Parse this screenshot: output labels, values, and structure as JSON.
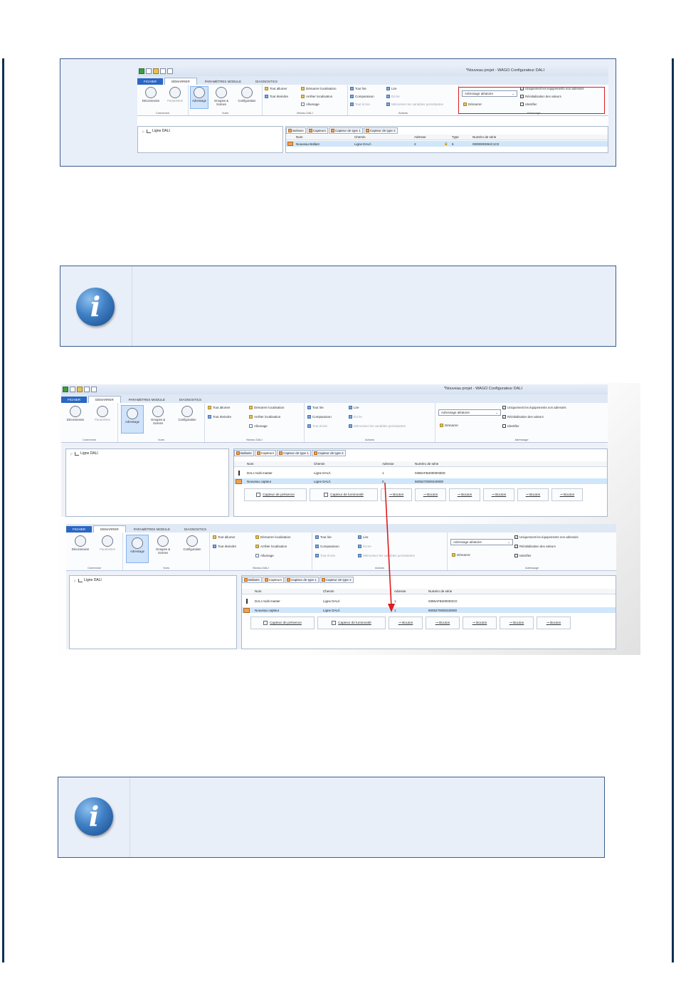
{
  "app": {
    "window_title": "*Nouveau projet - WAGO Configurateur DALI",
    "tabs": [
      "FICHIER",
      "DÉMARRER",
      "PARAMÈTRES MODULE",
      "DIAGNOSTICS"
    ]
  },
  "ribbon": {
    "connexion": {
      "deconnexion": "Déconnexion",
      "parametres": "Paramètres",
      "label": "Connexion"
    },
    "vues": {
      "adressage": "Adressage",
      "groupes": "Groupes & Scènes",
      "configuration": "Configuration",
      "label": "Vues"
    },
    "niveau": {
      "tout_allumer": "Tout allumer",
      "tout_eteindre": "Tout éteindre",
      "demarrer_loc": "Démarrer localisation",
      "arreter_loc": "Arrêter localisation",
      "allumage": "Allumage",
      "label": "Niveau DALI"
    },
    "actions": {
      "tout_lire": "Tout lire",
      "comparaison": "Comparaison",
      "tout_ecrire": "Tout écrire",
      "lire": "Lire",
      "ecrire": "Écrire",
      "memoriser": "Mémoriser les variables persistantes",
      "label": "Actions"
    },
    "adressage": {
      "mode": "Adressage aléatoire",
      "demarrer": "Démarrer",
      "opt1": "Uniquement les équipements non adressés",
      "opt2": "Réinitialisation des valeurs",
      "opt3": "Identifier",
      "label": "Adressage"
    }
  },
  "tree": {
    "root": "Ligne DALI"
  },
  "grid_tabs": [
    "Ballasts",
    "Capteurs",
    "Capteur de type 1",
    "Capteur de type 2"
  ],
  "grid_headers": [
    "Nom",
    "Chemin",
    "Adresse",
    "Type",
    "Numéro de série"
  ],
  "screenshot1": {
    "rows": [
      {
        "nom": "Nouveau Ballast",
        "chemin": "Ligne DALI\\",
        "adresse": "2",
        "type": "6",
        "serie": "0000000D84C1C0"
      }
    ]
  },
  "screenshot2": {
    "top_rows": [
      {
        "nom": "DALI multi master",
        "chemin": "Ligne DALI\\",
        "adresse": "1",
        "serie": "0396AFB4000003DD"
      },
      {
        "nom": "Nouveau capteur",
        "chemin": "Ligne DALI\\",
        "adresse": "0",
        "serie": "5005270000340000"
      }
    ],
    "bottom_rows": [
      {
        "nom": "DALI multi master",
        "chemin": "Ligne DALI\\",
        "adresse": "1",
        "serie": "0396AFB400003CO"
      },
      {
        "nom": "Nouveau capteur",
        "chemin": "Ligne DALI\\",
        "adresse": "1",
        "serie": "5005270000340000"
      }
    ],
    "buttons": {
      "presence": "Capteur de présence",
      "luminosite": "Capteur de luminosité",
      "bouton": "Bouton"
    }
  },
  "colors": {
    "frame": "#3a5e8c",
    "panel_bg": "#e9eff8",
    "highlight": "#e01b1b",
    "selected_row": "#cfe6fb"
  },
  "icons": [
    "info-icon",
    "disconnect-icon",
    "gear-icon",
    "lightbulb-icon"
  ]
}
